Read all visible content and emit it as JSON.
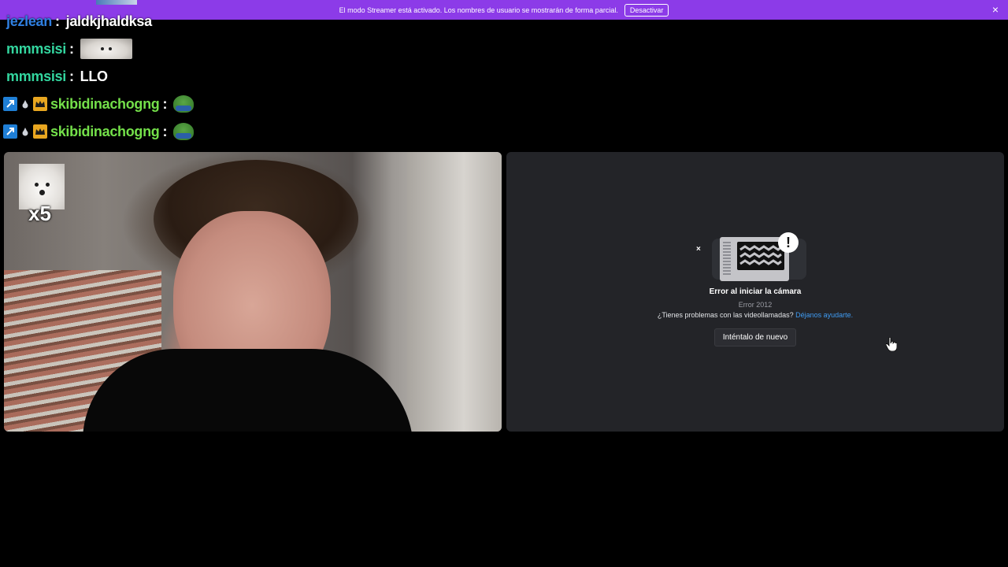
{
  "banner": {
    "text": "El modo Streamer está activado. Los nombres de usuario se mostrarán de forma parcial.",
    "button_label": "Desactivar",
    "close_icon": "×",
    "background": "#8c3be8"
  },
  "chat": {
    "messages": [
      {
        "username": "jezlean",
        "color": "#2f7fe0",
        "text": "jaldkjhaldksa",
        "emote": null,
        "badges": []
      },
      {
        "username": "mmmsisi",
        "color": "#33d69f",
        "text": "",
        "emote": "dog-emote",
        "badges": []
      },
      {
        "username": "mmmsisi",
        "color": "#33d69f",
        "text": "LLO",
        "emote": null,
        "badges": []
      },
      {
        "username": "skibidinachogng",
        "color": "#74e04a",
        "text": "",
        "emote": "pepe-emote",
        "badges": [
          "prime-badge",
          "drop-badge",
          "crown-badge"
        ]
      },
      {
        "username": "skibidinachogng",
        "color": "#74e04a",
        "text": "",
        "emote": "pepe-emote",
        "badges": [
          "prime-badge",
          "drop-badge",
          "crown-badge"
        ]
      }
    ],
    "separator": ":"
  },
  "video_left": {
    "reaction_emote": "dog-emote",
    "reaction_count": "x5"
  },
  "video_right": {
    "error_title": "Error al iniciar la cámara",
    "error_code": "Error 2012",
    "help_text": "¿Tienes problemas con las videollamadas?",
    "help_link": "Déjanos ayudarte.",
    "retry_label": "Inténtalo de nuevo",
    "close_mark": "×",
    "alert_mark": "!"
  }
}
